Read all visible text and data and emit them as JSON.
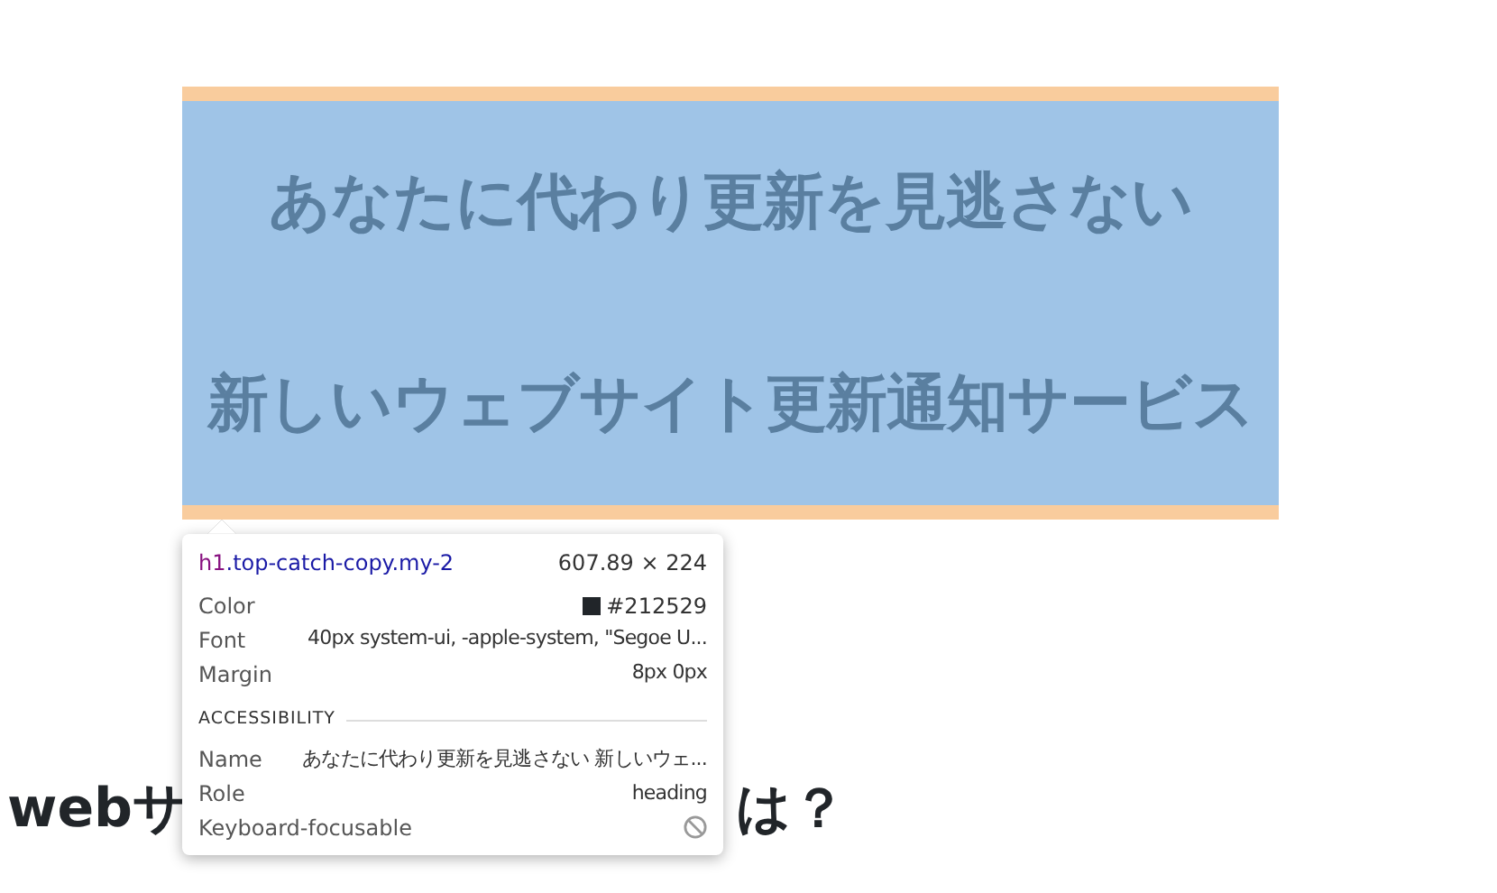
{
  "heading": {
    "lines": [
      "あなたに代わり更新を見逃さない",
      "新しいウェブサイト更新通知サービス"
    ]
  },
  "subheading_parts": [
    "webサ",
    "は？"
  ],
  "inspector_tooltip": {
    "tag": "h1",
    "selector": ".top-catch-copy.my-2",
    "size": "607.89 × 224",
    "properties": [
      {
        "kind": "color",
        "label": "Color",
        "value": "#212529"
      },
      {
        "kind": "text",
        "label": "Font",
        "value": "40px system-ui, -apple-system, \"Segoe U..."
      },
      {
        "kind": "text",
        "label": "Margin",
        "value": "8px 0px"
      }
    ],
    "section_title": "ACCESSIBILITY",
    "accessibility": [
      {
        "kind": "text",
        "label": "Name",
        "value": "あなたに代わり更新を見逃さない 新しいウェ..."
      },
      {
        "kind": "text",
        "label": "Role",
        "value": "heading"
      },
      {
        "kind": "blocked",
        "label": "Keyboard-focusable"
      }
    ]
  }
}
